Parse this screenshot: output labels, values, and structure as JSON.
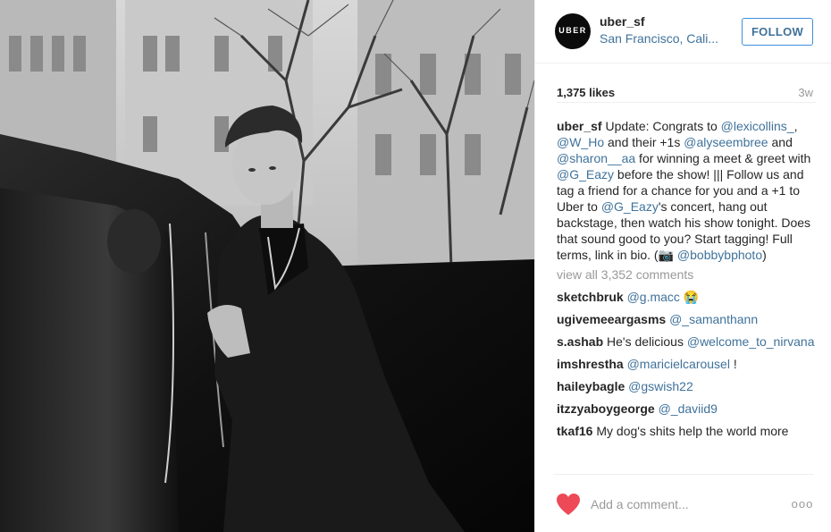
{
  "post": {
    "username": "uber_sf",
    "location": "San Francisco, Cali...",
    "avatar_label": "UBER",
    "follow_label": "FOLLOW",
    "likes": "1,375 likes",
    "time_ago": "3w"
  },
  "caption": {
    "user": "uber_sf",
    "t1": " Update: Congrats to ",
    "m1": "@lexicollins_",
    "t2": ", ",
    "m2": "@W_Ho",
    "t3": " and their +1s ",
    "m3": "@alyseembree",
    "t4": " and ",
    "m4": "@sharon__aa",
    "t5": " for winning a meet & greet with ",
    "m5": "@G_Eazy",
    "t6": " before the show! ||| Follow us and tag a friend for a chance for you and a +1 to Uber to ",
    "m6": "@G_Eazy",
    "t7": "'s concert, hang out backstage, then watch his show tonight. Does that sound good to you? Start tagging! Full terms, link in bio. (📷 ",
    "m7": "@bobbybphoto",
    "t8": ")"
  },
  "view_all": "view all 3,352 comments",
  "comments": [
    {
      "user": "sketchbruk",
      "mention": "@g.macc",
      "text": " 😭"
    },
    {
      "user": "ugivemeeargasms",
      "mention": "@_samanthann",
      "text": ""
    },
    {
      "user": "s.ashab",
      "pre": "He's delicious ",
      "mention": "@welcome_to_nirvana",
      "text": ""
    },
    {
      "user": "imshrestha",
      "mention": "@maricielcarousel",
      "text": " !"
    },
    {
      "user": "haileybagle",
      "mention": "@gswish22",
      "text": ""
    },
    {
      "user": "itzzyaboygeorge",
      "mention": "@_daviid9",
      "text": ""
    },
    {
      "user": "tkaf16",
      "mention": "",
      "text": "My dog's shits help the world more"
    }
  ],
  "footer": {
    "comment_placeholder": "Add a comment...",
    "more_label": "ooo"
  },
  "icons": {
    "heart": "heart-icon",
    "more": "more-options-icon"
  },
  "colors": {
    "link": "#3f729b",
    "heart": "#ed4956",
    "follow_border": "#4090db"
  }
}
